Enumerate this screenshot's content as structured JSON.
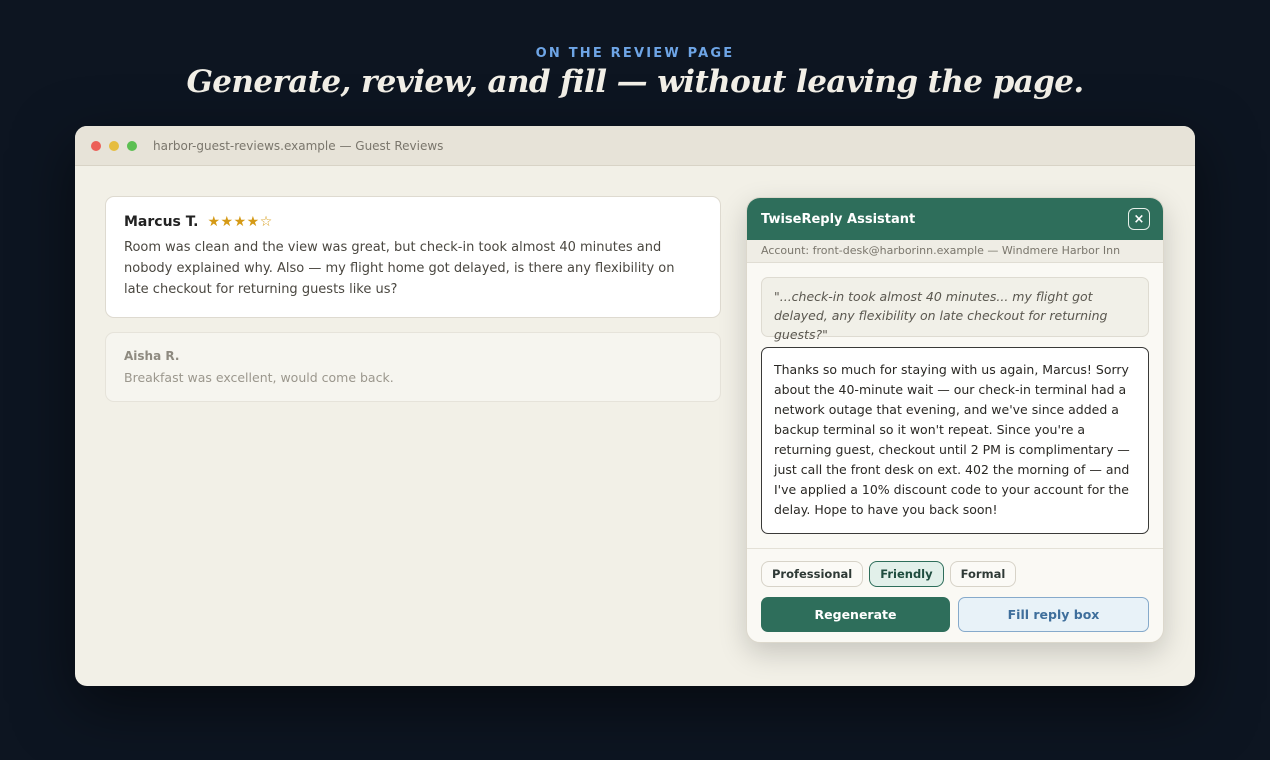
{
  "hero": {
    "eyebrow": "ON THE REVIEW PAGE",
    "headline": "Generate, review, and fill — without leaving the page."
  },
  "window": {
    "url": "harbor-guest-reviews.example — Guest Reviews"
  },
  "reviews": [
    {
      "name": "Marcus T.",
      "stars": "★★★★☆",
      "rating": 4,
      "text": "Room was clean and the view was great, but check-in took almost 40 minutes and nobody explained why. Also — my flight home got delayed, is there any flexibility on late checkout for returning guests like us?"
    },
    {
      "name": "Aisha R.",
      "text": "Breakfast was excellent, would come back."
    }
  ],
  "assistant": {
    "title": "TwiseReply Assistant",
    "close_label": "×",
    "account": "Account: front-desk@harborinn.example — Windmere Harbor Inn",
    "quote": "\"...check-in took almost 40 minutes... my flight got delayed, any flexibility on late checkout for returning guests?\"",
    "draft": "Thanks so much for staying with us again, Marcus! Sorry about the 40-minute wait — our check-in terminal had a network outage that evening, and we've since added a backup terminal so it won't repeat. Since you're a returning guest, checkout until 2 PM is complimentary — just call the front desk on ext. 402 the morning of — and I've applied a 10% discount code to your account for the delay. Hope to have you back soon!",
    "tones": [
      {
        "label": "Professional",
        "active": false
      },
      {
        "label": "Friendly",
        "active": true
      },
      {
        "label": "Formal",
        "active": false
      }
    ],
    "regenerate_label": "Regenerate",
    "fill_label": "Fill reply box"
  },
  "colors": {
    "background": "#0d1521",
    "accent": "#2e6e5b",
    "star": "#d59a16",
    "eyebrow": "#6ea5e6"
  }
}
